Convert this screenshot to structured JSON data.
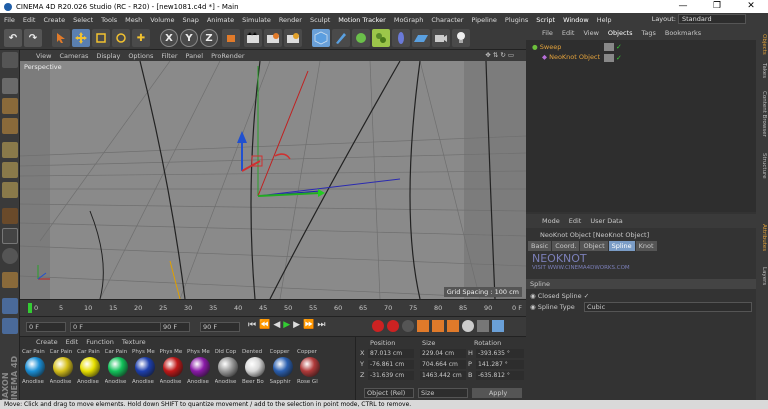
{
  "window": {
    "title": "CINEMA 4D R20.026 Studio (RC - R20) - [new1081.c4d *] - Main",
    "controls": [
      "—",
      "❐",
      "✕"
    ]
  },
  "menubar": {
    "items": [
      "File",
      "Edit",
      "Create",
      "Select",
      "Tools",
      "Mesh",
      "Volume",
      "Snap",
      "Animate",
      "Simulate",
      "Render",
      "Sculpt",
      "Motion Tracker",
      "MoGraph",
      "Character",
      "Pipeline",
      "Plugins",
      "Script",
      "Window",
      "Help"
    ],
    "layout_label": "Layout:",
    "layout_value": "Standard"
  },
  "toolbar": {
    "undo_icon": "↶",
    "axis_buttons": [
      "X",
      "Y",
      "Z"
    ]
  },
  "viewport": {
    "menu": [
      "View",
      "Cameras",
      "Display",
      "Options",
      "Filter",
      "Panel",
      "ProRender"
    ],
    "camera_label": "Perspective",
    "grid_spacing": "Grid Spacing : 100 cm"
  },
  "timeline": {
    "ticks": [
      "0",
      "5",
      "10",
      "15",
      "20",
      "25",
      "30",
      "35",
      "40",
      "45",
      "50",
      "55",
      "60",
      "65",
      "70",
      "75",
      "80",
      "85",
      "90"
    ],
    "frame_end_label": "0 F"
  },
  "transport": {
    "current_frame": "0 F",
    "start_frame": "0 F",
    "min_frame": "90 F",
    "max_frame": "90 F"
  },
  "materials": {
    "menu": [
      "Create",
      "Edit",
      "Function",
      "Texture"
    ],
    "items": [
      {
        "label": "Car Pain",
        "color": "#1a8fd6"
      },
      {
        "label": "Car Pain",
        "color": "#d6c01a"
      },
      {
        "label": "Car Pain",
        "color": "#e8e000"
      },
      {
        "label": "Car Pain",
        "color": "#12c25a"
      },
      {
        "label": "Phys Me",
        "color": "#1d3fae"
      },
      {
        "label": "Phys Me",
        "color": "#c01818"
      },
      {
        "label": "Phys Me",
        "color": "#8a1aa8"
      },
      {
        "label": "Old Cop",
        "color": "#9a9a9a"
      },
      {
        "label": "Dented",
        "color": "#d8d8d8"
      },
      {
        "label": "Copper",
        "color": "#2a5fb0"
      },
      {
        "label": "Copper",
        "color": "#b03a3a"
      }
    ],
    "sublabels": [
      "Anodise",
      "Anodise",
      "Anodise",
      "Anodise",
      "Anodise",
      "Anodise",
      "Anodise",
      "Anodise",
      "Beer Bo",
      "Sapphir",
      "Rose Gl"
    ]
  },
  "coordinates": {
    "headers": [
      "Position",
      "Size",
      "Rotation"
    ],
    "rows": [
      {
        "axis": "X",
        "pos": "87.013 cm",
        "size": "229.04 cm",
        "rot_axis": "H",
        "rot": "-393.635 °"
      },
      {
        "axis": "Y",
        "pos": "-76.861 cm",
        "size": "704.664 cm",
        "rot_axis": "P",
        "rot": "141.287 °"
      },
      {
        "axis": "Z",
        "pos": "-31.639 cm",
        "size": "1463.442 cm",
        "rot_axis": "B",
        "rot": "-635.812 °"
      }
    ],
    "mode": "Object (Rel)",
    "size_mode": "Size",
    "apply": "Apply"
  },
  "objects": {
    "menu": [
      "File",
      "Edit",
      "View",
      "Objects",
      "Tags",
      "Bookmarks"
    ],
    "tree": [
      "Sweep",
      "NeoKnot Object"
    ]
  },
  "attributes": {
    "menu": [
      "Mode",
      "Edit",
      "User Data"
    ],
    "title": "NeoKnot Object [NeoKnot Object]",
    "tabs": [
      "Basic",
      "Coord.",
      "Object",
      "Spline",
      "Knot"
    ],
    "active_tab": "Spline",
    "watermark_title": "NEOKNOT",
    "watermark_url": "VISIT WWW.CINEMA4DWORKS.COM",
    "section": "Spline",
    "closed_spline_label": "Closed Spline",
    "closed_spline_check": "✓",
    "spline_type_label": "Spline Type",
    "spline_type_value": "Cubic"
  },
  "side_tabs": [
    "Objects",
    "Takes",
    "Content Browser",
    "Structure",
    "Attributes",
    "Layers"
  ],
  "status": "Move: Click and drag to move elements. Hold down SHIFT to quantize movement / add to the selection in point mode, CTRL to remove."
}
